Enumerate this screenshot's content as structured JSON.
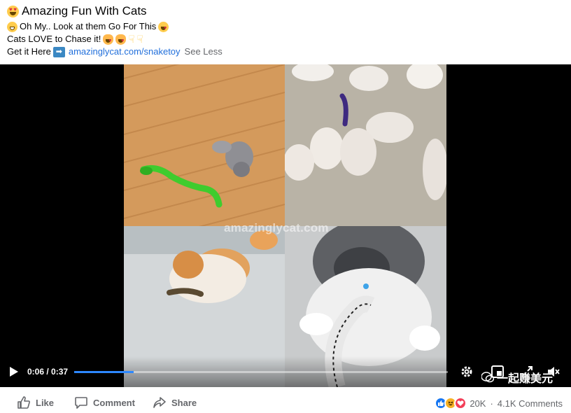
{
  "post": {
    "page_name": "Amazing Fun With Cats",
    "line1_text": "Oh My.. Look at them Go For This",
    "line2_text": "Cats LOVE to Chase it!",
    "line3_prefix": "Get it Here",
    "link_text": "amazinglycat.com/snaketoy",
    "see_less": "See Less"
  },
  "video": {
    "watermark": "amazinglycat.com",
    "current_time": "0:06",
    "duration": "0:37",
    "time_display": "0:06 / 0:37",
    "progress_fraction": 0.16,
    "accent_color": "#2d88ff"
  },
  "overlay": {
    "wechat_text": "一起赚美元"
  },
  "actions": {
    "like": "Like",
    "comment": "Comment",
    "share": "Share"
  },
  "reactions": {
    "count": "20K",
    "comments": "4.1K Comments",
    "types": [
      "like-icon",
      "haha-icon",
      "love-icon"
    ]
  }
}
